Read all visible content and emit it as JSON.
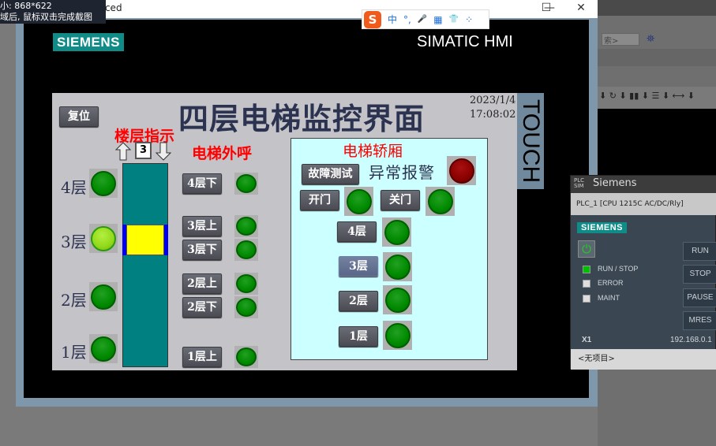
{
  "window": {
    "title_fragment": "anced",
    "minimize": "—",
    "maximize": "☐",
    "close": "✕"
  },
  "capture_overlay": {
    "size_text": "小: 868*622",
    "hint": "域后, 鼠标双击完成截图"
  },
  "ime_toolbar": {
    "logo": "S",
    "items": [
      "中",
      "°,",
      "🎤",
      "▦",
      "👕",
      "⁘"
    ]
  },
  "hmi": {
    "brand": "SIEMENS",
    "model": "SIMATIC HMI",
    "touch": "TOUCH",
    "reset_button": "复位",
    "title": "四层电梯监控界面",
    "date": "2023/1/4",
    "time": "17:08:02",
    "floor_indicator": {
      "heading": "楼层指示",
      "current_floor": "3",
      "floors": [
        {
          "label": "4层",
          "on": false
        },
        {
          "label": "3层",
          "on": true
        },
        {
          "label": "2层",
          "on": false
        },
        {
          "label": "1层",
          "on": false
        }
      ]
    },
    "hall_calls": {
      "heading": "电梯外呼",
      "buttons": [
        "4层下",
        "3层上",
        "3层下",
        "2层上",
        "2层下",
        "1层上"
      ]
    },
    "car": {
      "heading": "电梯轿厢",
      "fault_test": "故障测试",
      "alarm_label": "异常报警",
      "open": "开门",
      "close": "关门",
      "floor_buttons": [
        "4层",
        "3层",
        "2层",
        "1层"
      ]
    }
  },
  "background_app": {
    "search_placeholder": "索>"
  },
  "plcsim": {
    "title": "Siemens",
    "device": "PLC_1 [CPU 1215C AC/DC/Rly]",
    "brand": "SIEMENS",
    "leds": [
      {
        "label": "RUN / STOP",
        "color": "#00c000"
      },
      {
        "label": "ERROR",
        "color": "#dddddd"
      },
      {
        "label": "MAINT",
        "color": "#dddddd"
      }
    ],
    "buttons": [
      "RUN",
      "STOP",
      "PAUSE",
      "MRES"
    ],
    "interface": "X1",
    "ip": "192.168.0.1",
    "project": "<无项目>"
  },
  "colors": {
    "lamp_green": "#008a00",
    "lamp_on": "#92d91a",
    "alarm": "#8b0000",
    "shaft": "#008080",
    "car": "#ffff00",
    "panel": "#ccffff"
  }
}
